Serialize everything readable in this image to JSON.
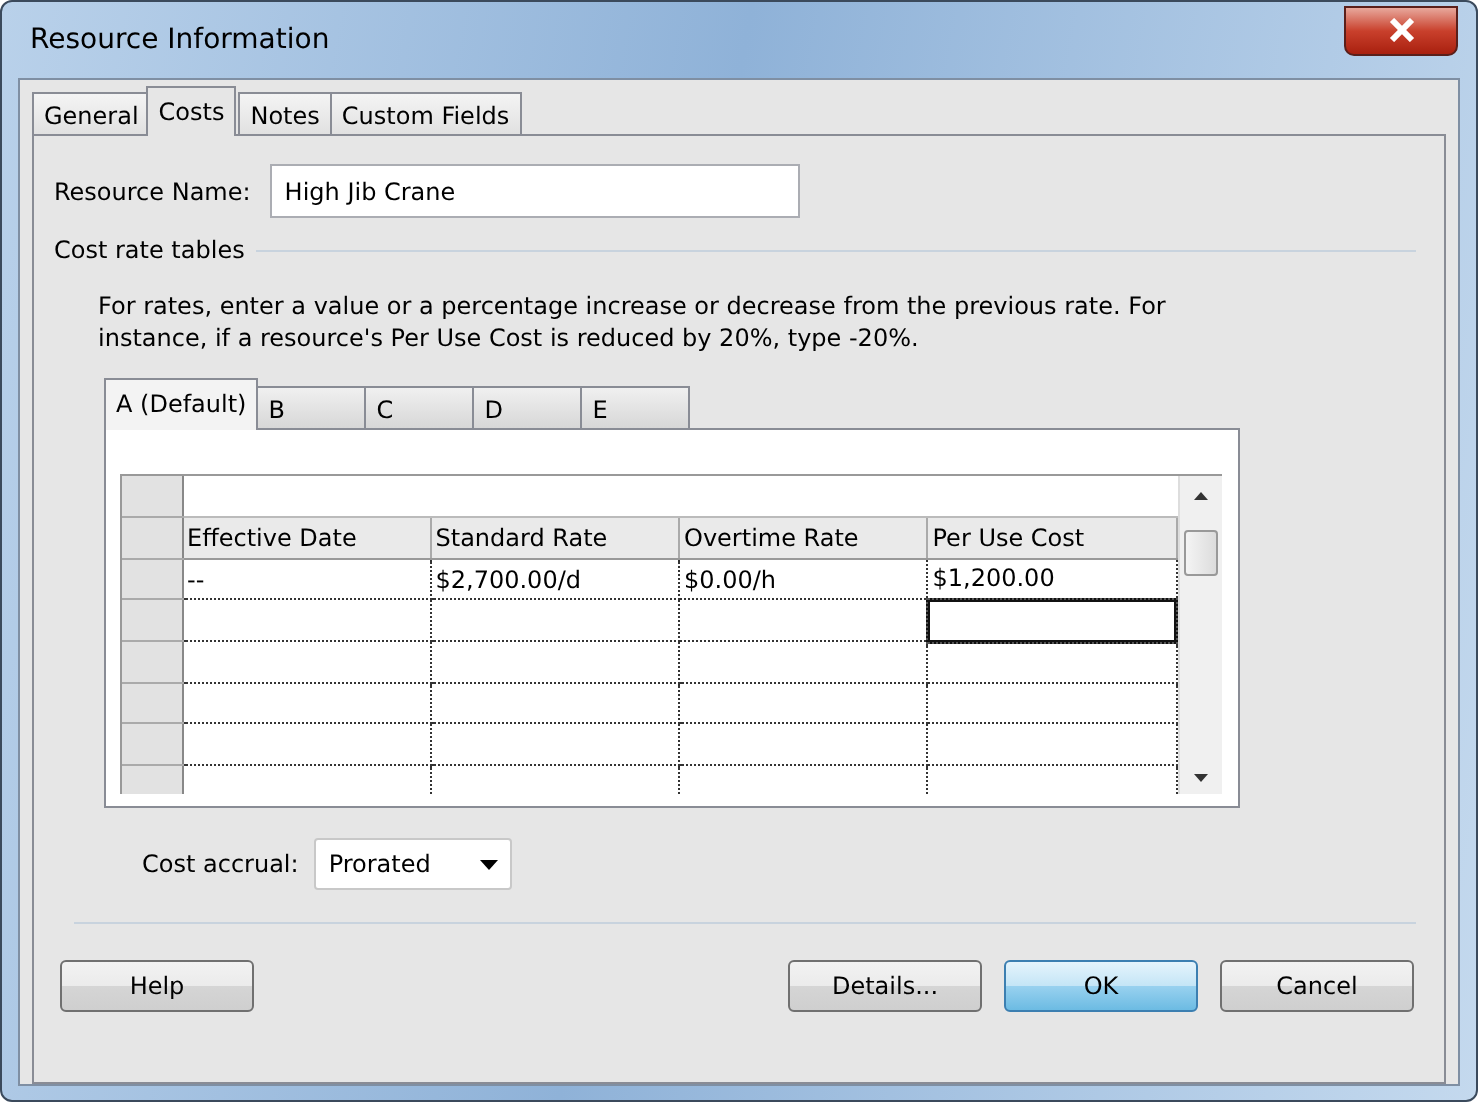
{
  "window": {
    "title": "Resource Information"
  },
  "tabs": [
    {
      "label": "General",
      "selected": false
    },
    {
      "label": "Costs",
      "selected": true
    },
    {
      "label": "Notes",
      "selected": false
    },
    {
      "label": "Custom Fields",
      "selected": false
    }
  ],
  "resource_name": {
    "label": "Resource Name:",
    "value": "High Jib Crane"
  },
  "cost_rate_tables": {
    "heading": "Cost rate tables",
    "instructions": "For rates, enter a value or a percentage increase or decrease from the previous rate. For instance, if a resource's Per Use Cost is reduced by 20%, type -20%.",
    "tabs": [
      {
        "label": "A (Default)",
        "selected": true
      },
      {
        "label": "B",
        "selected": false
      },
      {
        "label": "C",
        "selected": false
      },
      {
        "label": "D",
        "selected": false
      },
      {
        "label": "E",
        "selected": false
      }
    ],
    "columns": [
      "Effective Date",
      "Standard Rate",
      "Overtime Rate",
      "Per Use Cost"
    ],
    "rows": [
      [
        "--",
        "$2,700.00/d",
        "$0.00/h",
        "$1,200.00"
      ]
    ],
    "blank_rows": [
      {
        "focused": true
      },
      {
        "focused": false
      },
      {
        "focused": false
      },
      {
        "focused": false
      },
      {
        "focused": false
      }
    ]
  },
  "cost_accrual": {
    "label": "Cost accrual:",
    "value": "Prorated"
  },
  "buttons": [
    {
      "label": "Help",
      "kind": "left",
      "default": false
    },
    {
      "label": "Details...",
      "kind": "right",
      "default": false
    },
    {
      "label": "OK",
      "kind": "right",
      "default": true
    },
    {
      "label": "Cancel",
      "kind": "right",
      "default": false
    }
  ]
}
